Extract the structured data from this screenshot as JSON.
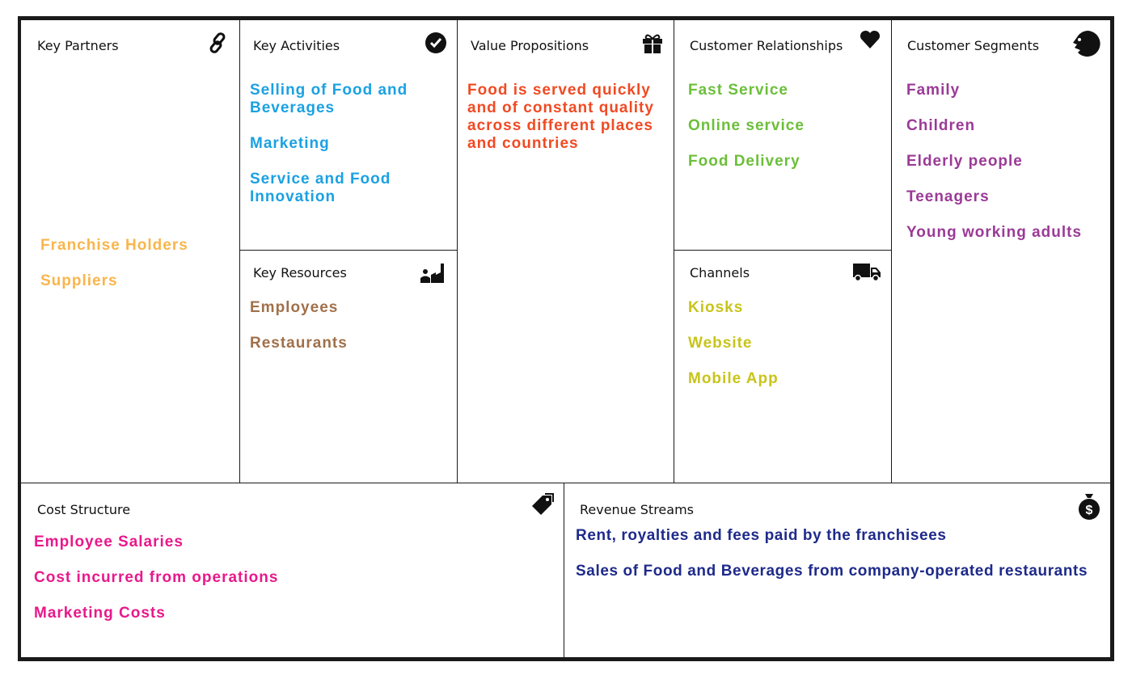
{
  "colors": {
    "partners": "#f9b54c",
    "activities": "#1ba1e2",
    "resources": "#a0704a",
    "value": "#f04a23",
    "relationships": "#6cbf3a",
    "channels": "#c8c41a",
    "segments": "#9b3a96",
    "cost": "#e8198b",
    "revenue": "#1e2a8a"
  },
  "key_partners": {
    "title": "Key Partners",
    "icon": "link-icon",
    "items": [
      "Franchise Holders",
      "Suppliers"
    ]
  },
  "key_activities": {
    "title": "Key Activities",
    "icon": "check-circle-icon",
    "items": [
      "Selling of Food and Beverages",
      "Marketing",
      "Service and Food Innovation"
    ]
  },
  "key_resources": {
    "title": "Key Resources",
    "icon": "factory-worker-icon",
    "items": [
      "Employees",
      "Restaurants"
    ]
  },
  "value_propositions": {
    "title": "Value Propositions",
    "icon": "gift-icon",
    "items": [
      "Food is served quickly and of constant quality across different places and countries"
    ]
  },
  "customer_relationships": {
    "title": "Customer Relationships",
    "icon": "heart-icon",
    "items": [
      "Fast Service",
      "Online service",
      "Food Delivery"
    ]
  },
  "channels": {
    "title": "Channels",
    "icon": "truck-icon",
    "items": [
      "Kiosks",
      "Website",
      "Mobile App"
    ]
  },
  "customer_segments": {
    "title": "Customer Segments",
    "icon": "face-icon",
    "items": [
      "Family",
      "Children",
      "Elderly people",
      "Teenagers",
      "Young working adults"
    ]
  },
  "cost_structure": {
    "title": "Cost Structure",
    "icon": "tag-icon",
    "items": [
      "Employee Salaries",
      "Cost incurred from operations",
      "Marketing Costs"
    ]
  },
  "revenue_streams": {
    "title": "Revenue Streams",
    "icon": "money-bag-icon",
    "items": [
      "Rent, royalties and fees paid by the franchisees",
      "Sales of Food and Beverages from company-operated restaurants"
    ]
  }
}
